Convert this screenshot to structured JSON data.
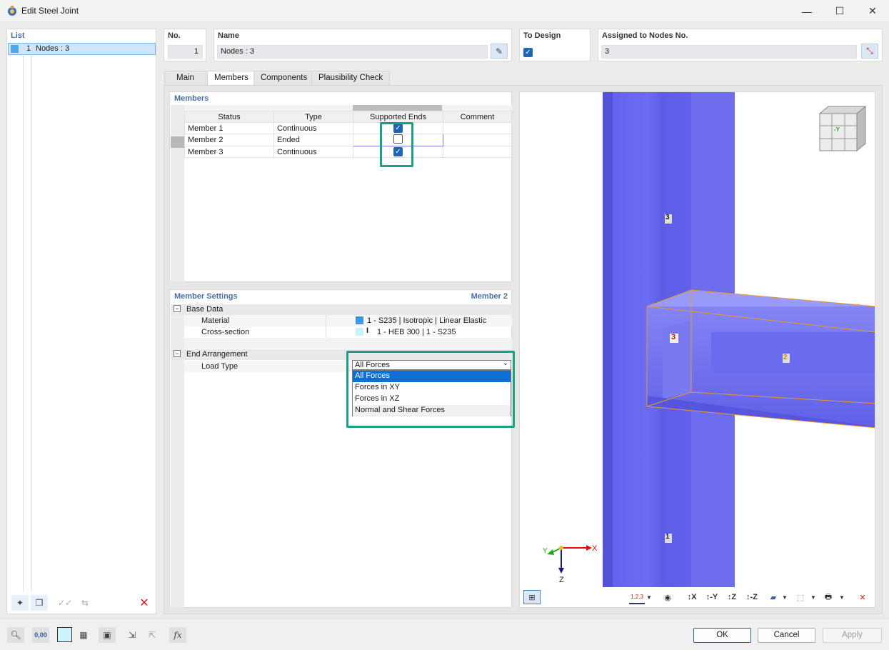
{
  "window": {
    "title": "Edit Steel Joint"
  },
  "list": {
    "header": "List",
    "items": [
      {
        "no": "1",
        "label": "Nodes : 3"
      }
    ]
  },
  "no": {
    "label": "No.",
    "value": "1"
  },
  "name": {
    "label": "Name",
    "value": "Nodes : 3"
  },
  "to_design": {
    "label": "To Design",
    "checked": true
  },
  "assigned": {
    "label": "Assigned to Nodes No.",
    "value": "3"
  },
  "tabs": [
    "Main",
    "Members",
    "Components",
    "Plausibility Check"
  ],
  "members": {
    "section_title": "Members",
    "columns": [
      "Status",
      "Type",
      "Supported Ends",
      "Comment"
    ],
    "rows": [
      {
        "status": "Member 1",
        "type": "Continuous",
        "supported": true,
        "comment": ""
      },
      {
        "status": "Member 2",
        "type": "Ended",
        "supported": false,
        "comment": ""
      },
      {
        "status": "Member 3",
        "type": "Continuous",
        "supported": true,
        "comment": ""
      }
    ]
  },
  "settings": {
    "title": "Member Settings",
    "member": "Member 2",
    "base_data": "Base Data",
    "material_label": "Material",
    "material_value": "1 - S235 | Isotropic | Linear Elastic",
    "cross_label": "Cross-section",
    "cross_value": "1 - HEB 300 | 1 - S235",
    "end_arrangement": "End Arrangement",
    "load_type_label": "Load Type",
    "load_type_value": "All Forces",
    "options": [
      "All Forces",
      "Forces in XY",
      "Forces in XZ",
      "Normal and Shear Forces"
    ]
  },
  "viewport": {
    "member_labels": [
      "3",
      "3",
      "2",
      "1"
    ],
    "axis_x": "X",
    "axis_y": "Y",
    "axis_z": "Z",
    "cube_label": "-Y",
    "member_color": "#6c6cf2"
  },
  "toolbar": {
    "xyz": [
      "X",
      "-Y",
      "Z",
      "-Z"
    ],
    "numbering": "1.2.3"
  },
  "bottom": {
    "ok": "OK",
    "cancel": "Cancel",
    "apply": "Apply",
    "units": "0,00"
  },
  "colors": {
    "accent": "#1f63b5",
    "highlight": "#1aa085",
    "selection": "#0d6fd4"
  }
}
